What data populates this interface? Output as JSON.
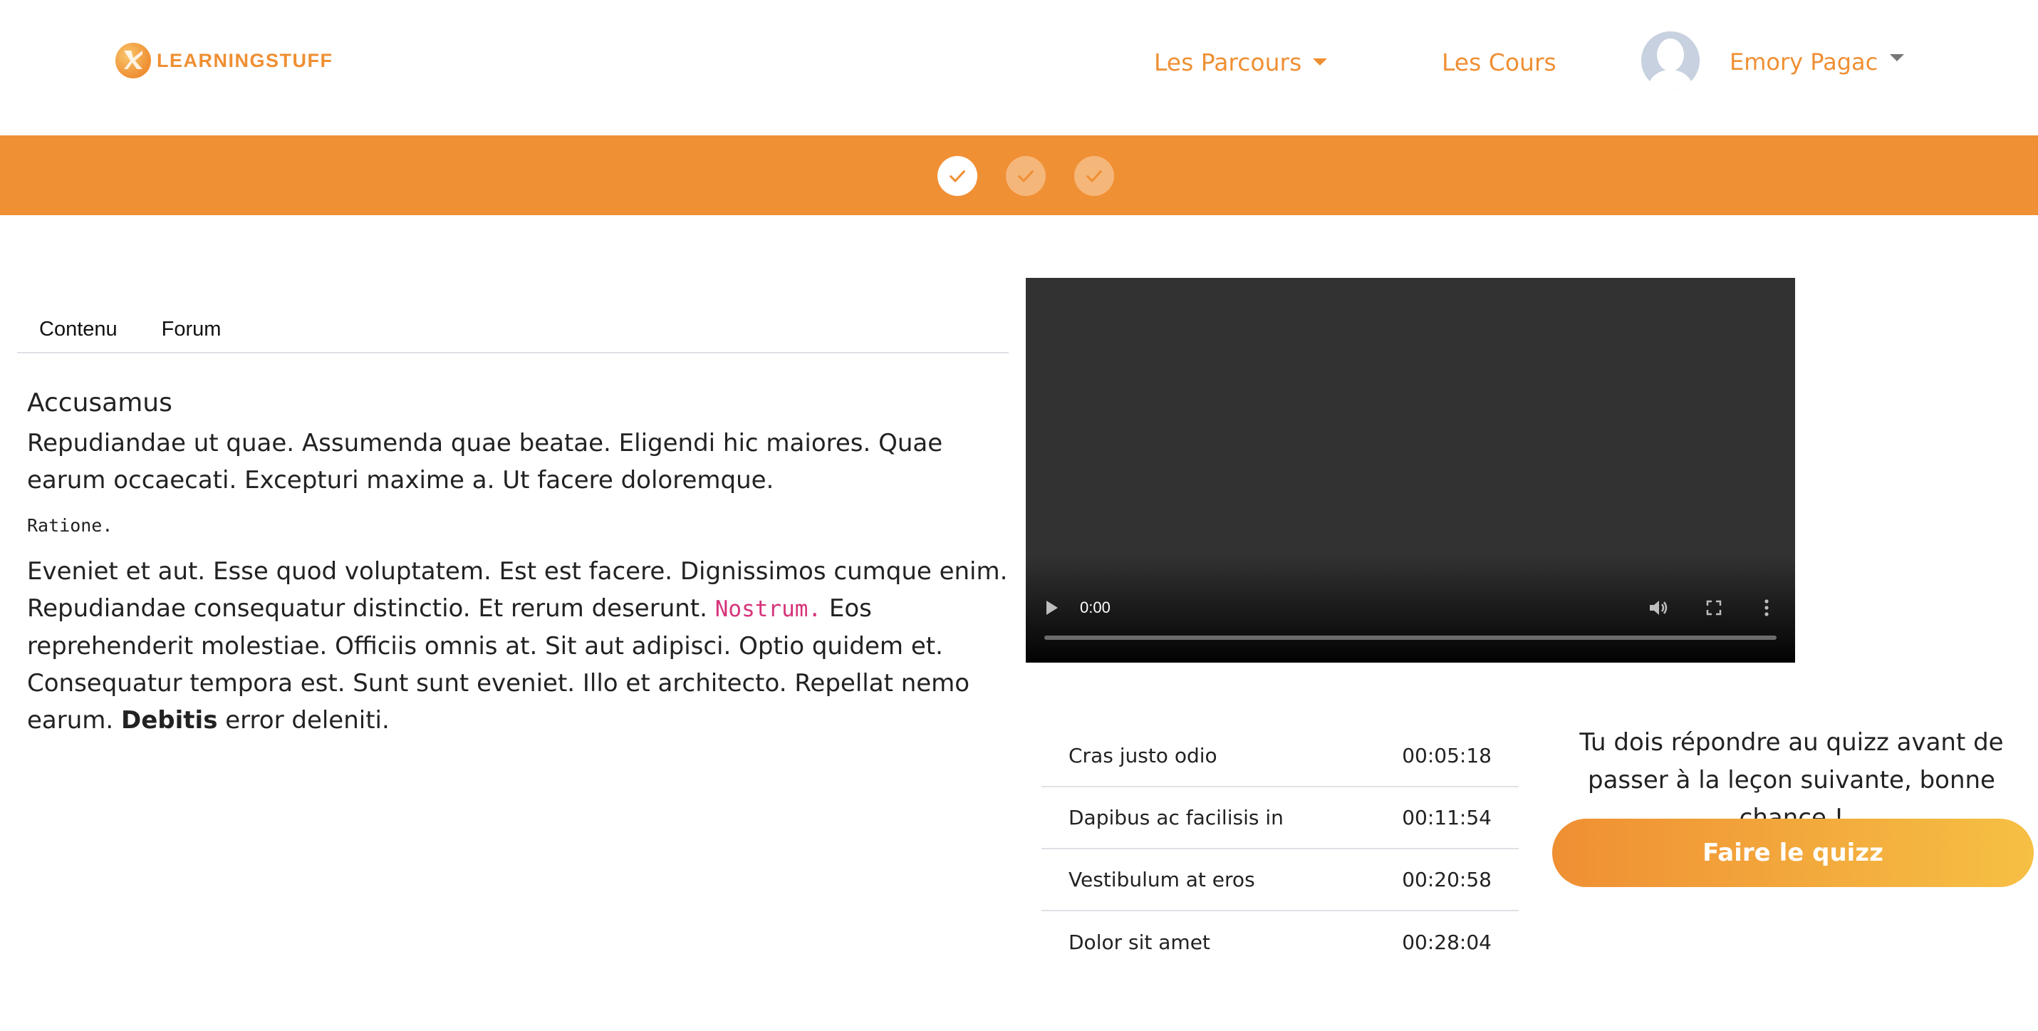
{
  "header": {
    "logo_text": "LEARNINGSTUFF",
    "nav": {
      "parcours_label": "Les Parcours",
      "cours_label": "Les Cours"
    },
    "user": {
      "name": "Emory Pagac"
    }
  },
  "colors": {
    "accent": "#f09034",
    "accent_light": "#f6c044",
    "code_pink": "#d6337a"
  },
  "steps": [
    {
      "state": "active",
      "icon": "check-icon"
    },
    {
      "state": "done",
      "icon": "check-icon"
    },
    {
      "state": "done",
      "icon": "check-icon"
    }
  ],
  "tabs": [
    {
      "label": "Contenu"
    },
    {
      "label": "Forum"
    }
  ],
  "content": {
    "title": "Accusamus",
    "lead": "Repudiandae ut quae. Assumenda quae beatae. Eligendi hic maiores. Quae earum occaecati. Excepturi maxime a. Ut facere doloremque.",
    "mono": "Ratione.",
    "body_part1": "Eveniet et aut. Esse quod voluptatem. Est est facere. Dignissimos cumque enim. Repudiandae consequatur distinctio. Et rerum deserunt. ",
    "body_code": "Nostrum.",
    "body_part2": " Eos reprehenderit molestiae. Officiis omnis at. Sit aut adipisci. Optio quidem et. Consequatur tempora est. Sunt sunt eveniet. Illo et architecto. Repellat nemo earum. ",
    "body_bold": "Debitis",
    "body_part3": " error deleniti."
  },
  "video": {
    "time": "0:00",
    "progress": 0
  },
  "chapters": [
    {
      "title": "Cras justo odio",
      "time": "00:05:18"
    },
    {
      "title": "Dapibus ac facilisis in",
      "time": "00:11:54"
    },
    {
      "title": "Vestibulum at eros",
      "time": "00:20:58"
    },
    {
      "title": "Dolor sit amet",
      "time": "00:28:04"
    }
  ],
  "quiz": {
    "message": "Tu dois répondre au quizz avant de passer à la leçon suivante, bonne chance !",
    "button_label": "Faire le quizz"
  }
}
